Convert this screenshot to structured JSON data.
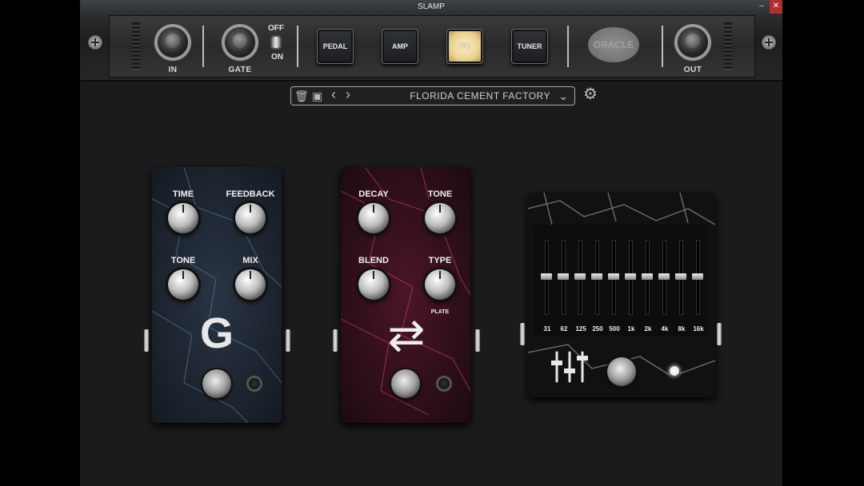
{
  "window": {
    "title": "SLAMP",
    "minimize_glyph": "–",
    "close_glyph": "✕"
  },
  "rack": {
    "in_label": "IN",
    "gate_label": "GATE",
    "toggle_off_label": "OFF",
    "toggle_on_label": "ON",
    "buttons": [
      {
        "label": "PEDAL",
        "active": false
      },
      {
        "label": "AMP",
        "active": false
      },
      {
        "label": "FX",
        "active": true
      },
      {
        "label": "TUNER",
        "active": false
      }
    ],
    "logo_text": "ORACLE",
    "out_label": "OUT"
  },
  "preset": {
    "name": "FLORIDA CEMENT FACTORY",
    "trash_icon": "🗑",
    "save_icon": "▣",
    "prev_icon": "‹",
    "next_icon": "›",
    "dropdown_icon": "⌄",
    "settings_icon": "⚙"
  },
  "delay_pedal": {
    "color": "#2f3f55",
    "knob_labels": [
      "TIME",
      "FEEDBACK",
      "TONE",
      "MIX"
    ],
    "symbol": "G"
  },
  "reverb_pedal": {
    "color": "#5a1834",
    "knob_labels": [
      "DECAY",
      "TONE",
      "BLEND",
      "TYPE"
    ],
    "type_value": "PLATE",
    "symbol": "⇄"
  },
  "eq_pedal": {
    "bands": [
      "31",
      "62",
      "125",
      "250",
      "500",
      "1k",
      "2k",
      "4k",
      "8k",
      "16k"
    ],
    "icon": "sliders-icon"
  }
}
